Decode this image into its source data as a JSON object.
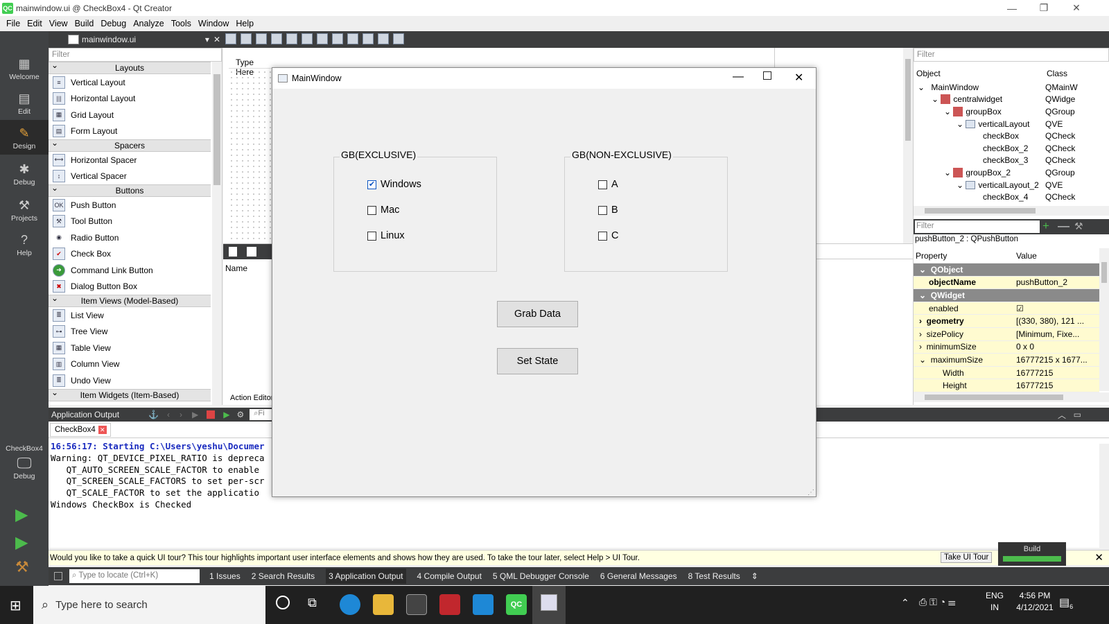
{
  "window": {
    "title": "mainwindow.ui @ CheckBox4 - Qt Creator",
    "logo": "QC"
  },
  "menu": [
    "File",
    "Edit",
    "View",
    "Build",
    "Debug",
    "Analyze",
    "Tools",
    "Window",
    "Help"
  ],
  "modes": [
    "Welcome",
    "Edit",
    "Design",
    "Debug",
    "Projects",
    "Help"
  ],
  "kit": {
    "project": "CheckBox4",
    "mode": "Debug"
  },
  "editor": {
    "file": "mainwindow.ui",
    "filter_placeholder": "Filter",
    "type_here": "Type Here",
    "name_col": "Name",
    "action_editor": "Action Editor"
  },
  "widgetbox": {
    "sections": [
      {
        "title": "Layouts",
        "items": [
          "Vertical Layout",
          "Horizontal Layout",
          "Grid Layout",
          "Form Layout"
        ]
      },
      {
        "title": "Spacers",
        "items": [
          "Horizontal Spacer",
          "Vertical Spacer"
        ]
      },
      {
        "title": "Buttons",
        "items": [
          "Push Button",
          "Tool Button",
          "Radio Button",
          "Check Box",
          "Command Link Button",
          "Dialog Button Box"
        ]
      },
      {
        "title": "Item Views (Model-Based)",
        "items": [
          "List View",
          "Tree View",
          "Table View",
          "Column View",
          "Undo View"
        ]
      },
      {
        "title": "Item Widgets (Item-Based)",
        "items": []
      }
    ]
  },
  "object_inspector": {
    "filter": "Filter",
    "col_object": "Object",
    "col_class": "Class",
    "rows": [
      {
        "name": "MainWindow",
        "cls": "QMainW"
      },
      {
        "name": "centralwidget",
        "cls": "QWidge"
      },
      {
        "name": "groupBox",
        "cls": "QGroup"
      },
      {
        "name": "verticalLayout",
        "cls": "QVE"
      },
      {
        "name": "checkBox",
        "cls": "QCheck"
      },
      {
        "name": "checkBox_2",
        "cls": "QCheck"
      },
      {
        "name": "checkBox_3",
        "cls": "QCheck"
      },
      {
        "name": "groupBox_2",
        "cls": "QGroup"
      },
      {
        "name": "verticalLayout_2",
        "cls": "QVE"
      },
      {
        "name": "checkBox_4",
        "cls": "QCheck"
      }
    ]
  },
  "property_editor": {
    "filter": "Filter",
    "selected": "pushButton_2 : QPushButton",
    "col_property": "Property",
    "col_value": "Value",
    "rows": [
      {
        "p": "QObject",
        "v": "",
        "group": true
      },
      {
        "p": "objectName",
        "v": "pushButton_2",
        "bold": true
      },
      {
        "p": "QWidget",
        "v": "",
        "group": true
      },
      {
        "p": "enabled",
        "v": "☑"
      },
      {
        "p": "geometry",
        "v": "[(330, 380), 121 ...",
        "bold": true
      },
      {
        "p": "sizePolicy",
        "v": "[Minimum, Fixe..."
      },
      {
        "p": "minimumSize",
        "v": "0 x 0"
      },
      {
        "p": "maximumSize",
        "v": "16777215 x 1677..."
      },
      {
        "p": "Width",
        "v": "16777215"
      },
      {
        "p": "Height",
        "v": "16777215"
      }
    ]
  },
  "output": {
    "title": "Application Output",
    "filter": "Fi",
    "tab": "CheckBox4",
    "lines": [
      "16:56:17: Starting C:\\Users\\yeshu\\Documer",
      "Warning: QT_DEVICE_PIXEL_RATIO is depreca",
      "   QT_AUTO_SCREEN_SCALE_FACTOR to enable",
      "   QT_SCREEN_SCALE_FACTORS to set per-scr",
      "   QT_SCALE_FACTOR to set the applicatio",
      "Windows CheckBox is Checked"
    ]
  },
  "tour": {
    "text": "Would you like to take a quick UI tour? This tour highlights important user interface elements and shows how they are used. To take the tour later, select Help > UI Tour.",
    "button": "Take UI Tour"
  },
  "build_label": "Build",
  "bottom": {
    "locate": "Type to locate (Ctrl+K)",
    "panes": [
      "1  Issues",
      "2  Search Results",
      "3  Application Output",
      "4  Compile Output",
      "5  QML Debugger Console",
      "6  General Messages",
      "8  Test Results"
    ]
  },
  "dialog": {
    "title": "MainWindow",
    "group1": {
      "title": "GB(EXCLUSIVE)",
      "items": [
        {
          "label": "Windows",
          "checked": true
        },
        {
          "label": "Mac",
          "checked": false
        },
        {
          "label": "Linux",
          "checked": false
        }
      ]
    },
    "group2": {
      "title": "GB(NON-EXCLUSIVE)",
      "items": [
        {
          "label": "A",
          "checked": false
        },
        {
          "label": "B",
          "checked": false
        },
        {
          "label": "C",
          "checked": false
        }
      ]
    },
    "btn1": "Grab Data",
    "btn2": "Set State"
  },
  "taskbar": {
    "search": "Type here to search",
    "lang1": "ENG",
    "lang2": "IN",
    "time": "4:56 PM",
    "date": "4/12/2021",
    "notif": "6"
  }
}
